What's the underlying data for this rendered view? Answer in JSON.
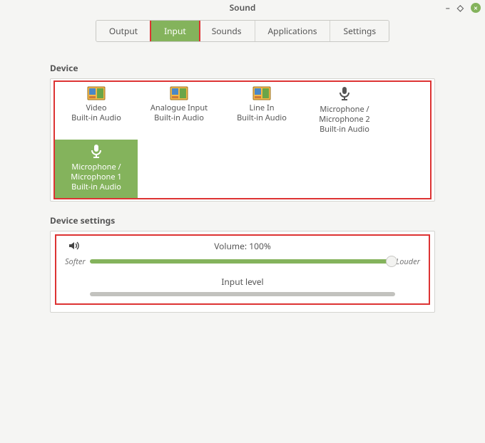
{
  "window": {
    "title": "Sound"
  },
  "tabs": {
    "output": "Output",
    "input": "Input",
    "sounds": "Sounds",
    "applications": "Applications",
    "settings": "Settings",
    "active": "input"
  },
  "sections": {
    "device": "Device",
    "device_settings": "Device settings"
  },
  "devices": [
    {
      "id": "video",
      "line1": "Video",
      "line2": "Built-in Audio",
      "icon": "audio-card",
      "selected": false
    },
    {
      "id": "analogue",
      "line1": "Analogue Input",
      "line2": "Built-in Audio",
      "icon": "audio-card",
      "selected": false
    },
    {
      "id": "linein",
      "line1": "Line In",
      "line2": "Built-in Audio",
      "icon": "audio-card",
      "selected": false
    },
    {
      "id": "mic2",
      "line1": "Microphone /",
      "line2": "Microphone 2",
      "line3": "Built-in Audio",
      "icon": "microphone",
      "selected": false
    },
    {
      "id": "mic1",
      "line1": "Microphone /",
      "line2": "Microphone 1",
      "line3": "Built-in Audio",
      "icon": "microphone",
      "selected": true
    }
  ],
  "settings": {
    "volume_label": "Volume: 100%",
    "volume_percent": 100,
    "softer": "Softer",
    "louder": "Louder",
    "input_level_label": "Input level"
  },
  "colors": {
    "accent": "#84b35c",
    "highlight": "#d33"
  }
}
